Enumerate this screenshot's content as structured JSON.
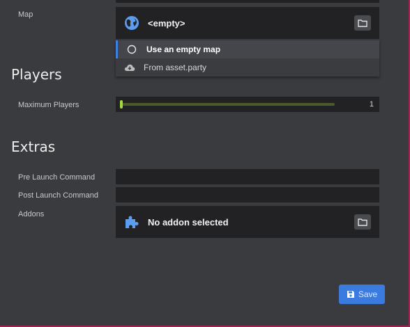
{
  "form": {
    "map_label": "Map",
    "map_value": "<empty>",
    "map_options": [
      {
        "label": "Use an empty map",
        "icon": "radio-empty-icon",
        "selected": true
      },
      {
        "label": "From asset.party",
        "icon": "cloud-download-icon",
        "selected": false
      }
    ],
    "players_heading": "Players",
    "max_players_label": "Maximum Players",
    "max_players_value": "1",
    "max_players_fraction": 0,
    "extras_heading": "Extras",
    "pre_launch_label": "Pre Launch Command",
    "pre_launch_value": "",
    "post_launch_label": "Post Launch Command",
    "post_launch_value": "",
    "addons_label": "Addons",
    "addons_value": "No addon selected",
    "save_label": "Save"
  },
  "colors": {
    "accent": "#3b7be0",
    "slider": "#a6d93d",
    "frame_border": "#9c2552"
  }
}
